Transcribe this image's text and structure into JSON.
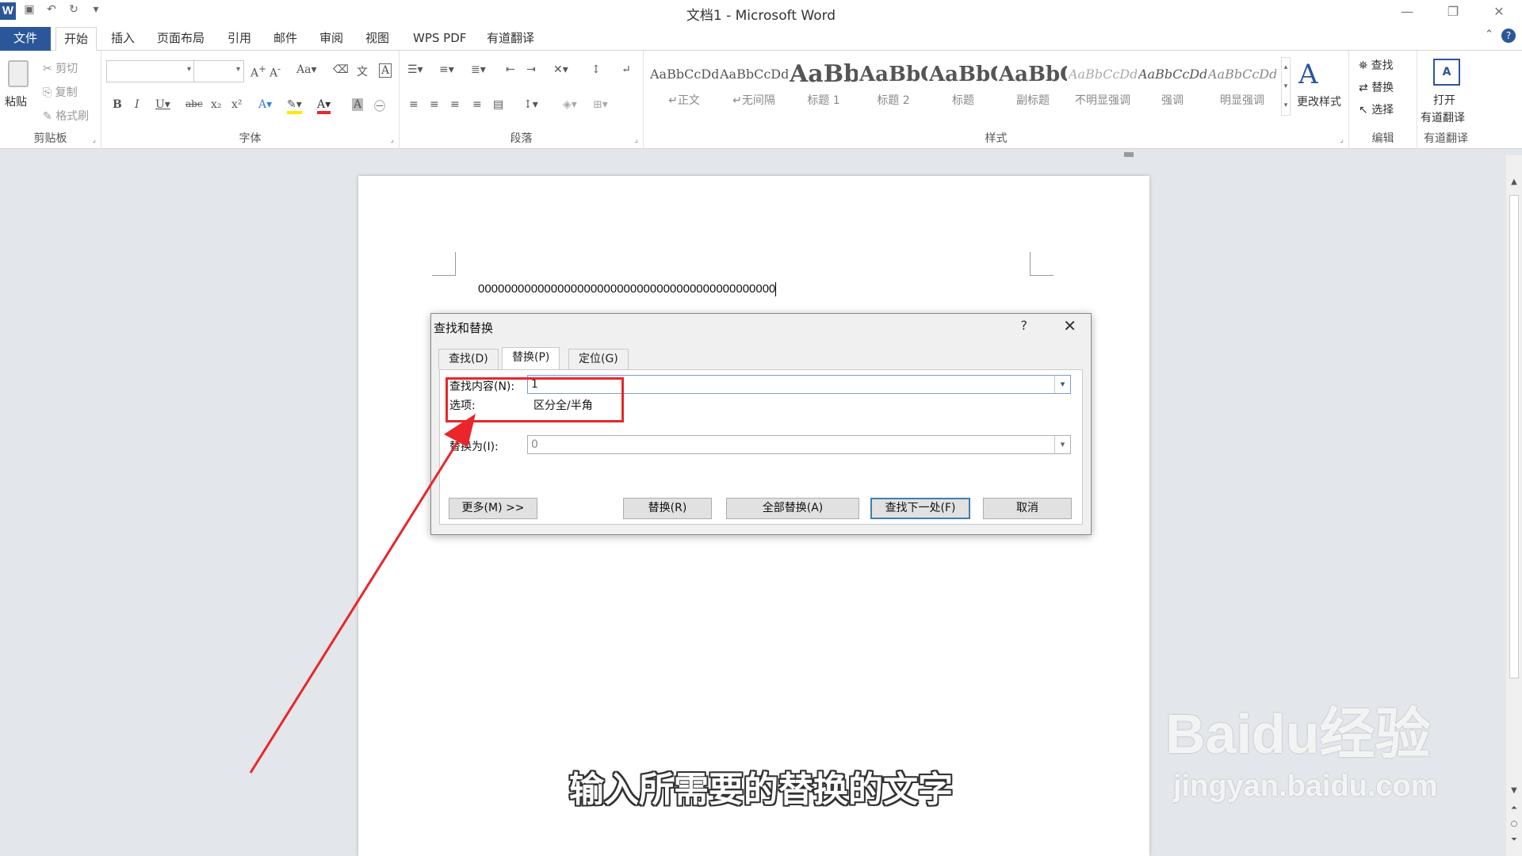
{
  "window": {
    "title": "文档1 - Microsoft Word"
  },
  "tabs": [
    "文件",
    "开始",
    "插入",
    "页面布局",
    "引用",
    "邮件",
    "审阅",
    "视图",
    "WPS PDF",
    "有道翻译"
  ],
  "ribbon": {
    "clipboard": {
      "paste": "粘贴",
      "cut": "剪切",
      "copy": "复制",
      "format_painter": "格式刷",
      "label": "剪贴板"
    },
    "font": {
      "label": "字体"
    },
    "paragraph": {
      "label": "段落"
    },
    "styles": {
      "label": "样式",
      "items": [
        {
          "preview": "AaBbCcDd",
          "name": "↵正文"
        },
        {
          "preview": "AaBbCcDd",
          "name": "↵无间隔"
        },
        {
          "preview": "AaBb",
          "name": "标题 1"
        },
        {
          "preview": "AaBbC",
          "name": "标题 2"
        },
        {
          "preview": "AaBbC",
          "name": "标题"
        },
        {
          "preview": "AaBbC",
          "name": "副标题"
        },
        {
          "preview": "AaBbCcDd",
          "name": "不明显强调"
        },
        {
          "preview": "AaBbCcDd",
          "name": "强调"
        },
        {
          "preview": "AaBbCcDd",
          "name": "明显强调"
        }
      ],
      "change_styles": "更改样式"
    },
    "editing": {
      "find": "查找",
      "replace": "替换",
      "select": "选择",
      "label": "编辑"
    },
    "youdao": {
      "open_line1": "打开",
      "open_line2": "有道翻译",
      "label": "有道翻译"
    }
  },
  "document": {
    "text": "000000000000000000000000000000000000000000000"
  },
  "dialog": {
    "title": "查找和替换",
    "help": "?",
    "tabs": [
      "查找(D)",
      "替换(P)",
      "定位(G)"
    ],
    "find_label": "查找内容(N):",
    "find_value": "1",
    "options_label": "选项:",
    "options_value": "区分全/半角",
    "replace_label": "替换为(I):",
    "replace_value": "0",
    "buttons": {
      "more": "更多(M) >>",
      "replace": "替换(R)",
      "replace_all": "全部替换(A)",
      "find_next": "查找下一处(F)",
      "cancel": "取消"
    }
  },
  "subtitle": "输入所需要的替换的文字",
  "watermark": {
    "line1": "Baidu经验",
    "line2": "jingyan.baidu.com"
  },
  "colors": {
    "accent": "#2b579a",
    "highlight": "#e8262b"
  }
}
